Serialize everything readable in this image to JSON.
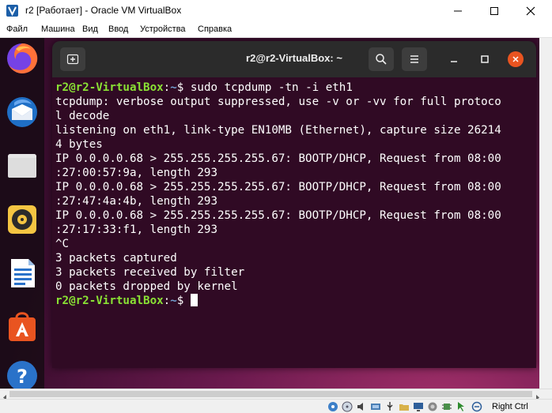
{
  "window": {
    "title": "r2 [Работает] - Oracle VM VirtualBox",
    "icons": [
      "virtualbox-icon",
      "minimize-icon",
      "maximize-icon",
      "close-icon"
    ]
  },
  "menubar": {
    "items": [
      "Файл",
      "Машина",
      "Вид",
      "Ввод",
      "Устройства",
      "Справка"
    ]
  },
  "dock": {
    "apps": [
      "firefox-icon",
      "thunderbird-icon",
      "files-icon",
      "rhythmbox-icon",
      "libreoffice-writer-icon",
      "ubuntu-software-icon",
      "help-icon"
    ]
  },
  "terminal": {
    "title": "r2@r2-VirtualBox: ~",
    "prompt_user": "r2@r2-VirtualBox",
    "prompt_sep": ":",
    "prompt_path": "~",
    "prompt_end": "$ ",
    "command": "sudo tcpdump -tn -i eth1",
    "output": [
      "tcpdump: verbose output suppressed, use -v or -vv for full protoco",
      "l decode",
      "listening on eth1, link-type EN10MB (Ethernet), capture size 26214",
      "4 bytes",
      "IP 0.0.0.0.68 > 255.255.255.255.67: BOOTP/DHCP, Request from 08:00",
      ":27:00:57:9a, length 293",
      "IP 0.0.0.0.68 > 255.255.255.255.67: BOOTP/DHCP, Request from 08:00",
      ":27:47:4a:4b, length 293",
      "IP 0.0.0.0.68 > 255.255.255.255.67: BOOTP/DHCP, Request from 08:00",
      ":27:17:33:f1, length 293",
      "^C",
      "3 packets captured",
      "3 packets received by filter",
      "0 packets dropped by kernel"
    ]
  },
  "statusbar": {
    "host_key": "Right Ctrl",
    "icons": [
      "hdd-icon",
      "optical-drive-icon",
      "audio-icon",
      "network-icon",
      "usb-icon",
      "shared-folders-icon",
      "display-icon",
      "recording-icon",
      "cpu-icon",
      "mouse-integration-icon",
      "keyboard-icon"
    ]
  },
  "colors": {
    "terminal_bg": "#300a24",
    "prompt_user": "#8ae234",
    "prompt_path": "#729fcf",
    "close_button": "#e95420"
  }
}
